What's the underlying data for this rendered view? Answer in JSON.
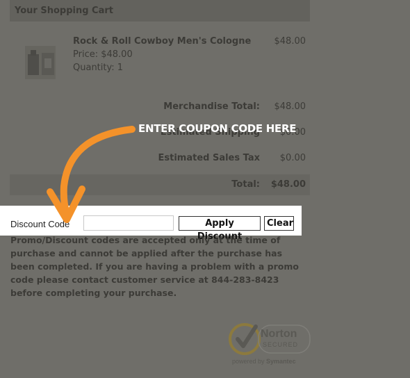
{
  "cart": {
    "title": "Your Shopping Cart",
    "item": {
      "name": "Rock & Roll Cowboy Men's Cologne",
      "price": "Price: $48.00",
      "quantity": "Quantity: 1",
      "line_price": "$48.00"
    },
    "summary": {
      "merch_label": "Merchandise Total:",
      "merch_value": "$48.00",
      "shipping_label": "Estimated Shipping",
      "shipping_value": "$0.00",
      "tax_label": "Estimated Sales Tax",
      "tax_value": "$0.00",
      "total_label": "Total:",
      "total_value": "$48.00"
    }
  },
  "discount": {
    "label": "Discount Code",
    "input_value": "",
    "apply_label": "Apply Discount",
    "clear_label": "Clear"
  },
  "promo_note": "Promo/Discount codes are accepted only at the time of purchase and cannot be applied after the purchase has been completed. If you are having a problem with a promo code please contact customer service at 844-283-8423 before completing your purchase.",
  "callout": "ENTER COUPON CODE HERE",
  "badge": {
    "name": "Norton",
    "sub": "SECURED",
    "powered_prefix": "powered by",
    "powered_brand": "Symantec"
  },
  "colors": {
    "overlay": "#6f6e69",
    "arrow": "#f4922a",
    "highlight": "#ffffff"
  },
  "icons": [
    "cologne-product-image",
    "arrow-icon",
    "norton-check-icon"
  ]
}
